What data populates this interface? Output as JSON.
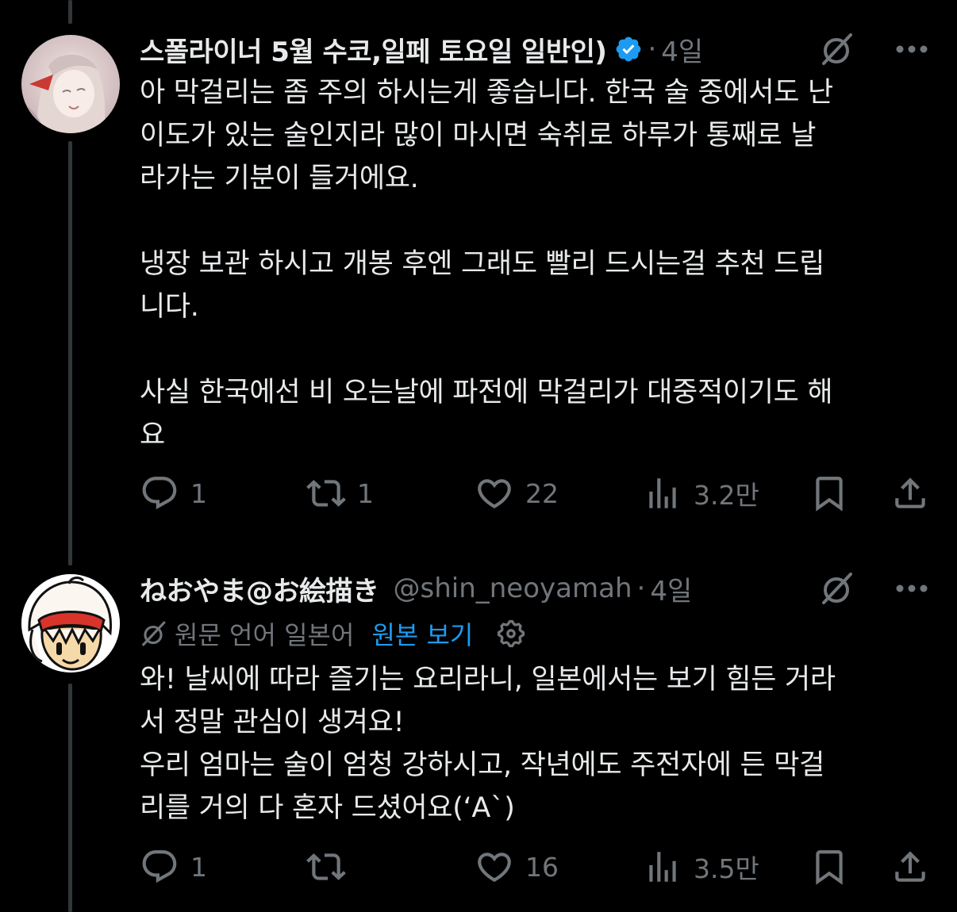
{
  "posts": [
    {
      "display_name": "스폴라이너 5월 수코,일페 토요일 일반인)",
      "verified": true,
      "handle": "",
      "time": "4일",
      "body": "아 막걸리는 좀 주의 하시는게 좋습니다. 한국 술 중에서도 난\n이도가 있는 술인지라 많이 마시면 숙취로 하루가 통째로 날\n라가는 기분이 들거에요.\n\n냉장 보관 하시고 개봉 후엔 그래도 빨리 드시는걸 추천 드립\n니다.\n\n사실 한국에선 비 오는날에 파전에 막걸리가 대중적이기도 해\n요",
      "actions": {
        "replies": "1",
        "reposts": "1",
        "likes": "22",
        "views": "3.2만"
      }
    },
    {
      "display_name": "ねおやま@お絵描き",
      "verified": false,
      "handle": "@shin_neoyamah",
      "time": "4일",
      "translation": {
        "language_label": "원문 언어 일본어",
        "view_original": "원본 보기"
      },
      "body": "와! 날씨에 따라 즐기는 요리라니, 일본에서는 보기 힘든 거라\n서 정말 관심이 생겨요!\n우리 엄마는 술이 엄청 강하시고, 작년에도 주전자에 든 막걸\n리를 거의 다 혼자 드셨어요(‘A`)",
      "actions": {
        "replies": "1",
        "reposts": "",
        "likes": "16",
        "views": "3.5만"
      }
    }
  ],
  "colors": {
    "background": "#000000",
    "text": "#e7e9ea",
    "muted": "#71767b",
    "link": "#1d9bf0",
    "verified": "#1d9bf0"
  },
  "icons": [
    "reply-icon",
    "repost-icon",
    "like-icon",
    "views-icon",
    "bookmark-icon",
    "share-icon",
    "grok-icon",
    "more-icon",
    "verified-icon",
    "translate-icon",
    "gear-icon"
  ]
}
